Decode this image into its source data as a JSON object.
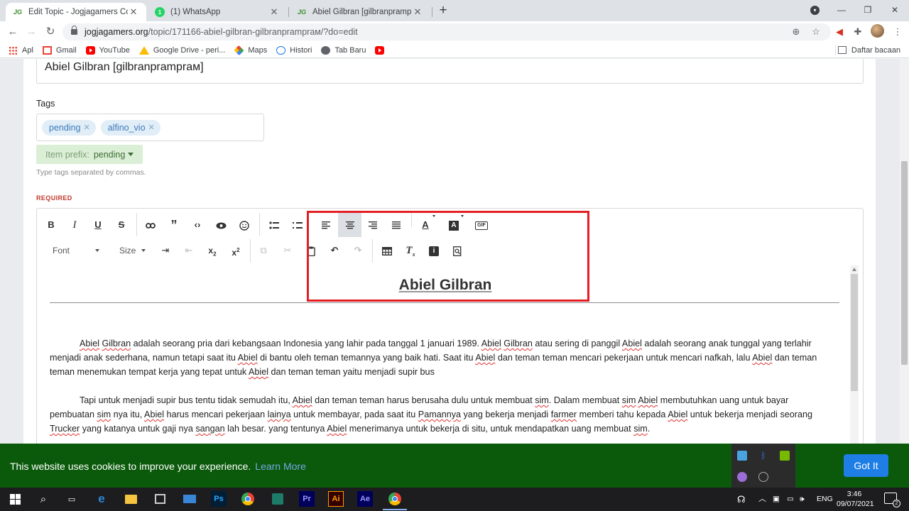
{
  "browser": {
    "tabs": [
      {
        "favicon": "JG",
        "title": "Edit Topic - Jogjagamers Commu",
        "active": true
      },
      {
        "favicon": "1",
        "title": "(1) WhatsApp",
        "active": false
      },
      {
        "favicon": "JG",
        "title": "Abiel Gilbran [gilbranpramprам]",
        "active": false
      }
    ],
    "url_host": "jogjagamers.org",
    "url_path": "/topic/171166-abiel-gilbran-gilbranpramprам/?do=edit",
    "bookmarks": [
      "Apl",
      "Gmail",
      "YouTube",
      "Google Drive - peri...",
      "Maps",
      "Histori",
      "Tab Baru",
      ""
    ],
    "reading_list": "Daftar bacaan"
  },
  "form": {
    "title_value": "Abiel Gilbran [gilbranpramprам]",
    "tags_label": "Tags",
    "tags": [
      "pending",
      "alfino_vio"
    ],
    "prefix_label": "Item prefix:",
    "prefix_value": "pending",
    "tags_hint": "Type tags separated by commas.",
    "required_label": "REQUIRED"
  },
  "editor": {
    "font_label": "Font",
    "size_label": "Size",
    "content_title": "Abiel Gilbran",
    "paragraph1_parts": [
      {
        "t": "Abiel",
        "s": true
      },
      {
        "t": " ",
        "s": false
      },
      {
        "t": "Gilbran",
        "s": true
      },
      {
        "t": " adalah seorang pria dari kebangsaan Indonesia yang lahir pada tanggal 1 januari 1989. ",
        "s": false
      },
      {
        "t": "Abiel",
        "s": true
      },
      {
        "t": " ",
        "s": false
      },
      {
        "t": "Gilbran",
        "s": true
      },
      {
        "t": " atau sering di panggil ",
        "s": false
      },
      {
        "t": "Abiel",
        "s": true
      },
      {
        "t": " adalah seorang anak tunggal yang terlahir menjadi anak sederhana, namun tetapi saat itu ",
        "s": false
      },
      {
        "t": "Abiel",
        "s": true
      },
      {
        "t": " di bantu oleh teman temannya yang baik hati. Saat itu ",
        "s": false
      },
      {
        "t": "Abiel",
        "s": true
      },
      {
        "t": " dan teman teman mencari pekerjaan untuk mencari nafkah, lalu ",
        "s": false
      },
      {
        "t": "Abiel",
        "s": true
      },
      {
        "t": " dan teman teman menemukan tempat kerja yang tepat untuk ",
        "s": false
      },
      {
        "t": "Abiel",
        "s": true
      },
      {
        "t": " dan teman teman yaitu menjadi supir bus",
        "s": false
      }
    ],
    "paragraph2_parts": [
      {
        "t": "Tapi untuk menjadi supir bus tentu tidak semudah itu, ",
        "s": false
      },
      {
        "t": "Abiel",
        "s": true
      },
      {
        "t": " dan teman teman harus berusaha dulu untuk membuat ",
        "s": false
      },
      {
        "t": "sim",
        "s": true
      },
      {
        "t": ". Dalam membuat ",
        "s": false
      },
      {
        "t": "sim",
        "s": true
      },
      {
        "t": " ",
        "s": false
      },
      {
        "t": "Abiel",
        "s": true
      },
      {
        "t": " membutuhkan uang untuk bayar pembuatan ",
        "s": false
      },
      {
        "t": "sim",
        "s": true
      },
      {
        "t": " nya itu, ",
        "s": false
      },
      {
        "t": "Abiel",
        "s": true
      },
      {
        "t": " harus mencari pekerjaan ",
        "s": false
      },
      {
        "t": "lainya",
        "s": true
      },
      {
        "t": " untuk membayar, pada saat itu ",
        "s": false
      },
      {
        "t": "Pamannya",
        "s": true
      },
      {
        "t": " yang bekerja menjadi ",
        "s": false
      },
      {
        "t": "farmer",
        "s": true
      },
      {
        "t": " memberi tahu kepada ",
        "s": false
      },
      {
        "t": "Abiel",
        "s": true
      },
      {
        "t": " untuk bekerja menjadi seorang ",
        "s": false
      },
      {
        "t": "Trucker",
        "s": true
      },
      {
        "t": " yang katanya untuk gaji nya ",
        "s": false
      },
      {
        "t": "sangan",
        "s": true
      },
      {
        "t": " lah besar. yang tentunya ",
        "s": false
      },
      {
        "t": "Abiel",
        "s": true
      },
      {
        "t": " menerimanya untuk bekerja di situ, untuk mendapatkan uang  membuat ",
        "s": false
      },
      {
        "t": "sim",
        "s": true
      },
      {
        "t": ".",
        "s": false
      }
    ]
  },
  "cookie_bar": {
    "message": "This website uses cookies to improve your experience.",
    "learn_more": "Learn More",
    "button": "Got It"
  },
  "taskbar": {
    "apps": [
      "Ps",
      "Pr",
      "Ai",
      "Ae"
    ],
    "language": "ENG",
    "time": "3:46",
    "date": "09/07/2021",
    "notifications": "2"
  },
  "colors": {
    "cookie_bg": "#0b5a0b",
    "got_it": "#1e7ee6",
    "tag_bg": "#e1edf7",
    "highlight_border": "#e31e24",
    "required": "#c0392b"
  }
}
